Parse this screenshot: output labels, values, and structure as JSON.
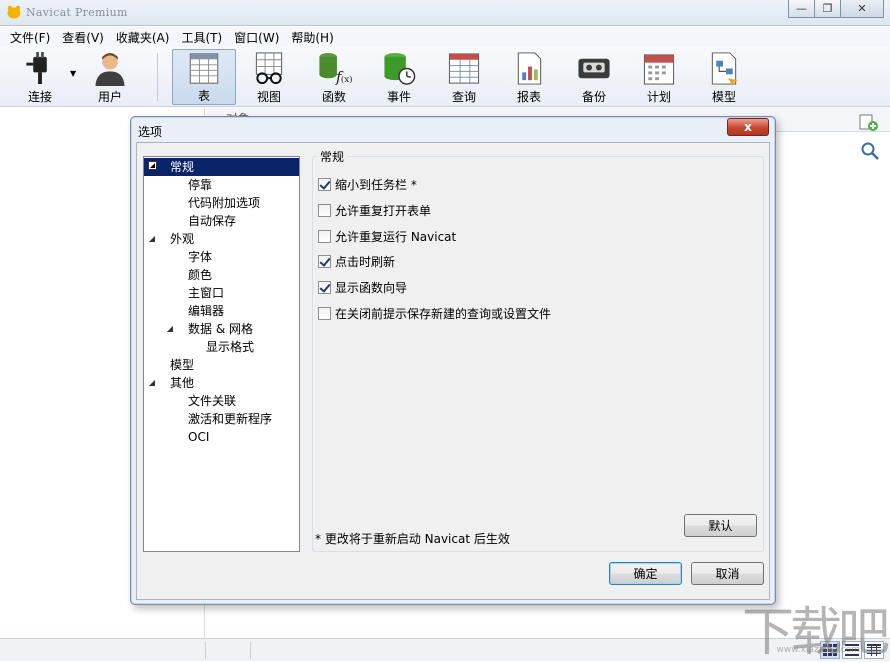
{
  "app": {
    "title": "Navicat Premium"
  },
  "window_controls": [
    "minimize-icon",
    "restore-icon",
    "close-icon"
  ],
  "menu": [
    "文件(F)",
    "查看(V)",
    "收藏夹(A)",
    "工具(T)",
    "窗口(W)",
    "帮助(H)"
  ],
  "toolbar": {
    "items": [
      {
        "label": "连接",
        "icon": "plug-icon"
      },
      {
        "label": "用户",
        "icon": "user-icon"
      },
      {
        "label": "表",
        "icon": "table-icon",
        "active": true
      },
      {
        "label": "视图",
        "icon": "view-glasses-icon"
      },
      {
        "label": "函数",
        "icon": "function-icon"
      },
      {
        "label": "事件",
        "icon": "event-clock-icon"
      },
      {
        "label": "查询",
        "icon": "query-icon"
      },
      {
        "label": "报表",
        "icon": "report-icon"
      },
      {
        "label": "备份",
        "icon": "backup-tape-icon"
      },
      {
        "label": "计划",
        "icon": "calendar-icon"
      },
      {
        "label": "模型",
        "icon": "model-icon"
      }
    ]
  },
  "background": {
    "object_tab": "对象"
  },
  "dialog": {
    "title": "选项",
    "close_label": "x",
    "tree": [
      {
        "label": "常规",
        "level": 0,
        "toggle": "expanded",
        "selected": true
      },
      {
        "label": "停靠",
        "level": 1
      },
      {
        "label": "代码附加选项",
        "level": 1
      },
      {
        "label": "自动保存",
        "level": 1
      },
      {
        "label": "外观",
        "level": 0,
        "toggle": "expanded"
      },
      {
        "label": "字体",
        "level": 1
      },
      {
        "label": "颜色",
        "level": 1
      },
      {
        "label": "主窗口",
        "level": 1
      },
      {
        "label": "编辑器",
        "level": 1
      },
      {
        "label": "数据 & 网格",
        "level": 1,
        "toggle": "expanded"
      },
      {
        "label": "显示格式",
        "level": 2
      },
      {
        "label": "模型",
        "level": 0
      },
      {
        "label": "其他",
        "level": 0,
        "toggle": "expanded"
      },
      {
        "label": "文件关联",
        "level": 1
      },
      {
        "label": "激活和更新程序",
        "level": 1
      },
      {
        "label": "OCI",
        "level": 1
      }
    ],
    "group_title": "常规",
    "options": [
      {
        "label": "缩小到任务栏 *",
        "checked": true
      },
      {
        "label": "允许重复打开表单",
        "checked": false
      },
      {
        "label": "允许重复运行 Navicat",
        "checked": false
      },
      {
        "label": "点击时刷新",
        "checked": true
      },
      {
        "label": "显示函数向导",
        "checked": true
      },
      {
        "label": "在关闭前提示保存新建的查询或设置文件",
        "checked": false
      }
    ],
    "note": "* 更改将于重新启动 Navicat 后生效",
    "default_button": "默认",
    "ok_button": "确定",
    "cancel_button": "取消"
  },
  "watermark": {
    "text": "下载吧",
    "sub": "www.xiazaiba.com"
  }
}
